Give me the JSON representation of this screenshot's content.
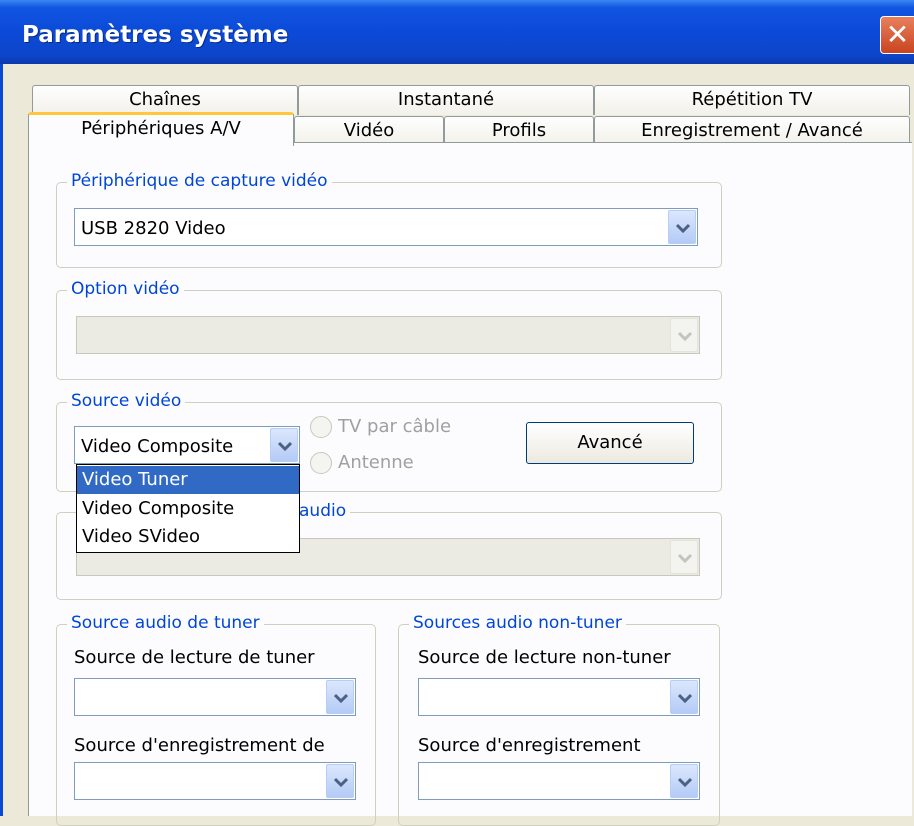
{
  "window": {
    "title": "Paramètres système",
    "close_glyph": "✕"
  },
  "tabs": {
    "row1": [
      {
        "label": "Chaînes"
      },
      {
        "label": "Instantané"
      },
      {
        "label": "Répétition TV"
      }
    ],
    "row2": [
      {
        "label": "Périphériques A/V",
        "active": true
      },
      {
        "label": "Vidéo"
      },
      {
        "label": "Profils"
      },
      {
        "label": "Enregistrement / Avancé"
      }
    ]
  },
  "capture": {
    "legend": "Périphérique de capture vidéo",
    "value": "USB 2820 Video"
  },
  "video_option": {
    "legend": "Option vidéo",
    "value": "",
    "disabled": true
  },
  "video_source": {
    "legend": "Source vidéo",
    "value": "Video Composite",
    "radio_cable": "TV par câble",
    "radio_antenna": "Antenne",
    "advanced_button": "Avancé",
    "options": [
      "Video Tuner",
      "Video Composite",
      "Video SVideo"
    ],
    "highlighted_option": "Video Tuner"
  },
  "audio_capture": {
    "legend_visible_fragment": "audio",
    "value": "",
    "disabled": true
  },
  "tuner_audio": {
    "legend": "Source audio de tuner",
    "playback_label": "Source de lecture de tuner",
    "record_label": "Source d'enregistrement de"
  },
  "nontuner_audio": {
    "legend": "Sources audio non-tuner",
    "playback_label": "Source de lecture non-tuner",
    "record_label": "Source d'enregistrement"
  },
  "colors": {
    "titlebar": "#0b4ad8",
    "legend_text": "#0046d5",
    "selection": "#316ac5",
    "tab_highlight": "#ffc83c"
  },
  "icons": {
    "combo_arrow": "chevron-down-icon",
    "close": "close-icon"
  }
}
